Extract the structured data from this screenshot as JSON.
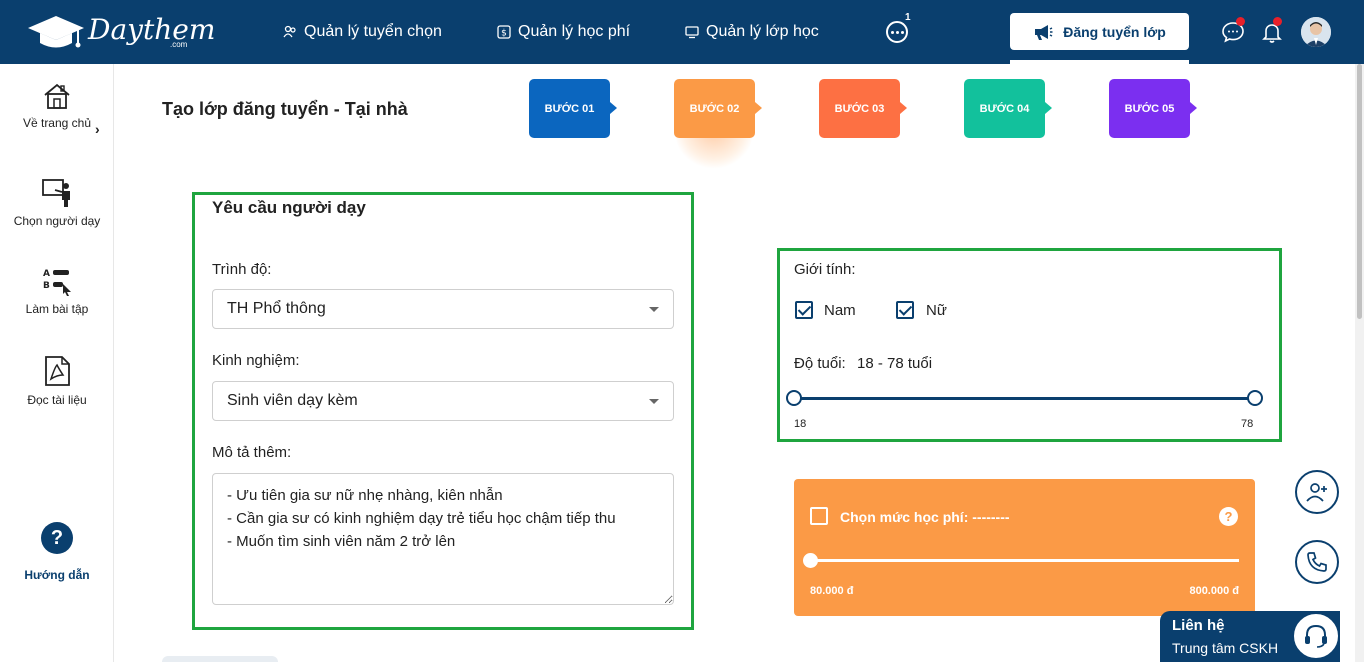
{
  "header": {
    "logo_text": "Daythem",
    "logo_sub": ".com",
    "nav": [
      {
        "label": "Quản lý tuyển chọn",
        "icon": "users-icon"
      },
      {
        "label": "Quản lý học phí",
        "icon": "dollar-icon"
      },
      {
        "label": "Quản lý lớp học",
        "icon": "monitor-icon"
      }
    ],
    "more_count": "1",
    "post_button": "Đăng tuyển lớp",
    "colors": {
      "primary": "#0a3f6e",
      "alert": "#e8202a"
    }
  },
  "sidebar": {
    "items": [
      {
        "label": "Về trang chủ",
        "icon": "home-icon"
      },
      {
        "label": "Chọn người dạy",
        "icon": "teacher-board-icon"
      },
      {
        "label": "Làm bài tập",
        "icon": "quiz-icon"
      },
      {
        "label": "Đọc tài liệu",
        "icon": "pdf-icon"
      }
    ],
    "arrow": "›",
    "help_symbol": "?",
    "help_label": "Hướng dẫn"
  },
  "main": {
    "title": "Tạo lớp đăng tuyển - Tại nhà",
    "steps": [
      {
        "label": "BƯỚC 01",
        "color": "#0b66bf"
      },
      {
        "label": "BƯỚC 02",
        "color": "#fb9a46"
      },
      {
        "label": "BƯỚC 03",
        "color": "#fd7043"
      },
      {
        "label": "BƯỚC 04",
        "color": "#12c19c"
      },
      {
        "label": "BƯỚC 05",
        "color": "#7b2ff0"
      }
    ],
    "requirements": {
      "title": "Yêu cầu người dạy",
      "level_label": "Trình độ:",
      "level_value": "TH Phổ thông",
      "experience_label": "Kinh nghiệm:",
      "experience_value": "Sinh viên dạy kèm",
      "desc_label": "Mô tả thêm:",
      "desc_value": "- Ưu tiên gia sư nữ nhẹ nhàng, kiên nhẫn\n- Cần gia sư có kinh nghiệm dạy trẻ tiểu học chậm tiếp thu\n- Muốn tìm sinh viên năm 2 trở lên"
    },
    "gender": {
      "label": "Giới tính:",
      "male": "Nam",
      "female": "Nữ",
      "male_checked": true,
      "female_checked": true
    },
    "age": {
      "label": "Độ tuổi:",
      "value_text": "18 - 78 tuổi",
      "min": "18",
      "max": "78"
    },
    "fee": {
      "label": "Chọn mức học phí: --------",
      "help": "?",
      "min": "80.000 đ",
      "max": "800.000 đ",
      "checked": false
    }
  },
  "contact": {
    "title": "Liên hệ",
    "subtitle": "Trung tâm CSKH"
  }
}
